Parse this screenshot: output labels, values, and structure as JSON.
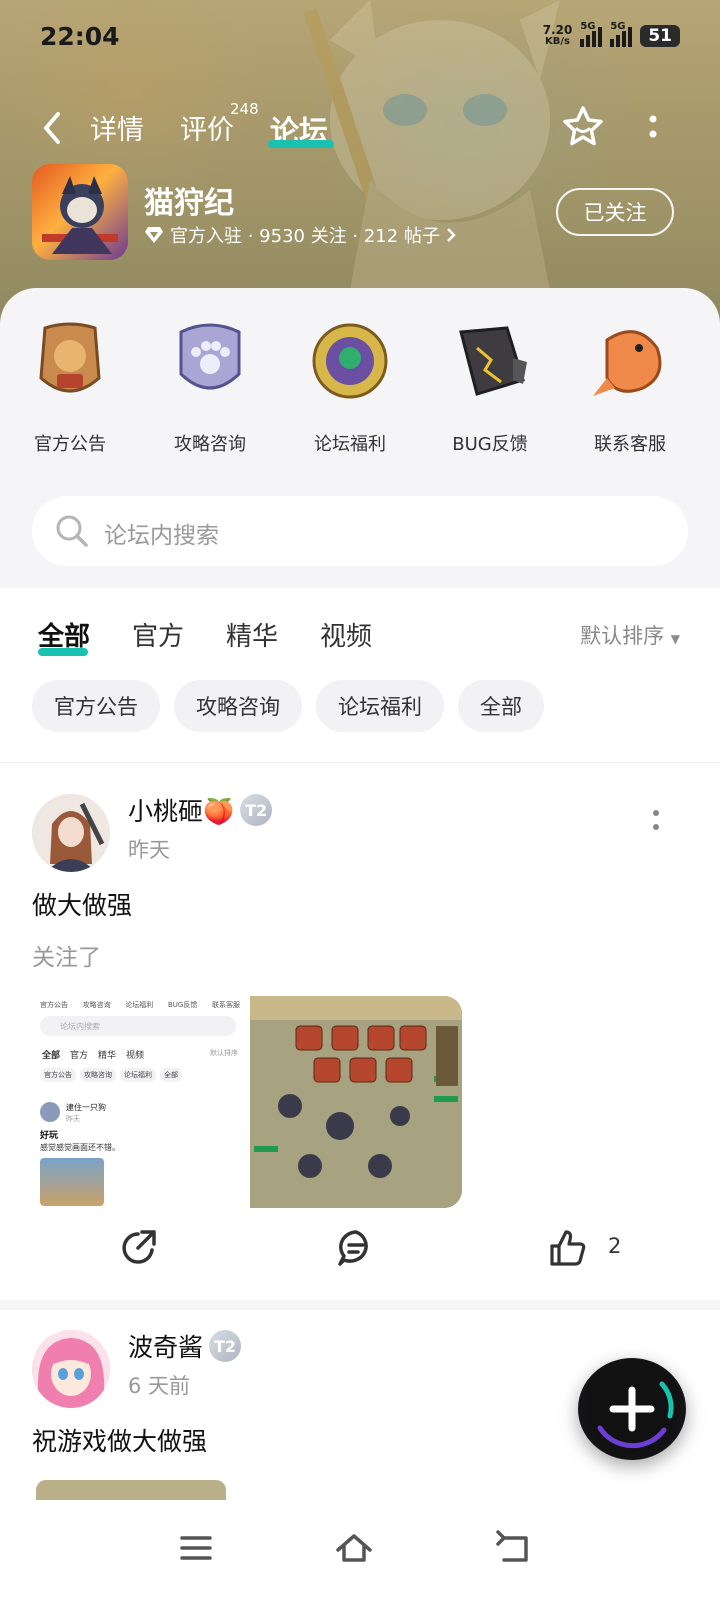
{
  "status_bar": {
    "time": "22:04",
    "net_speed_value": "7.20",
    "net_speed_unit": "KB/s",
    "signal_1_label": "5G",
    "signal_2_label": "5G",
    "battery": "51"
  },
  "nav": {
    "tabs": [
      {
        "label": "详情"
      },
      {
        "label": "评价",
        "badge": "248"
      },
      {
        "label": "论坛",
        "active": true
      }
    ]
  },
  "game": {
    "name": "猫狩纪",
    "meta": "官方入驻 · 9530 关注 · 212 帖子",
    "follow_label": "已关注"
  },
  "categories": [
    {
      "label": "官方公告",
      "icon": "announcement-badge-icon"
    },
    {
      "label": "攻略咨询",
      "icon": "paw-shield-icon"
    },
    {
      "label": "论坛福利",
      "icon": "gem-medallion-icon"
    },
    {
      "label": "BUG反馈",
      "icon": "cracked-stone-icon"
    },
    {
      "label": "联系客服",
      "icon": "koi-fish-icon"
    }
  ],
  "search": {
    "placeholder": "论坛内搜索"
  },
  "filter_tabs": [
    {
      "label": "全部",
      "active": true
    },
    {
      "label": "官方"
    },
    {
      "label": "精华"
    },
    {
      "label": "视频"
    }
  ],
  "sort_label": "默认排序",
  "chips": [
    "官方公告",
    "攻略咨询",
    "论坛福利",
    "全部"
  ],
  "posts": [
    {
      "author": "小桃砸🍑",
      "level": "T2",
      "time": "昨天",
      "title": "做大做强",
      "body": "关注了",
      "like_count": "2",
      "thumb1": {
        "tabs": [
          "官方公告",
          "攻略咨询",
          "论坛福利",
          "BUG反馈",
          "联系客服"
        ],
        "search": "论坛内搜索",
        "filters": [
          "全部",
          "官方",
          "精华",
          "视频"
        ],
        "sort": "默认排序",
        "chips": [
          "官方公告",
          "攻略咨询",
          "论坛福利",
          "全部"
        ],
        "author": "逮住一只狗",
        "time": "昨天",
        "title": "好玩",
        "body": "感觉感觉画面还不错。"
      }
    },
    {
      "author": "波奇酱",
      "level": "T2",
      "time": "6 天前",
      "title": "祝游戏做大做强"
    }
  ]
}
